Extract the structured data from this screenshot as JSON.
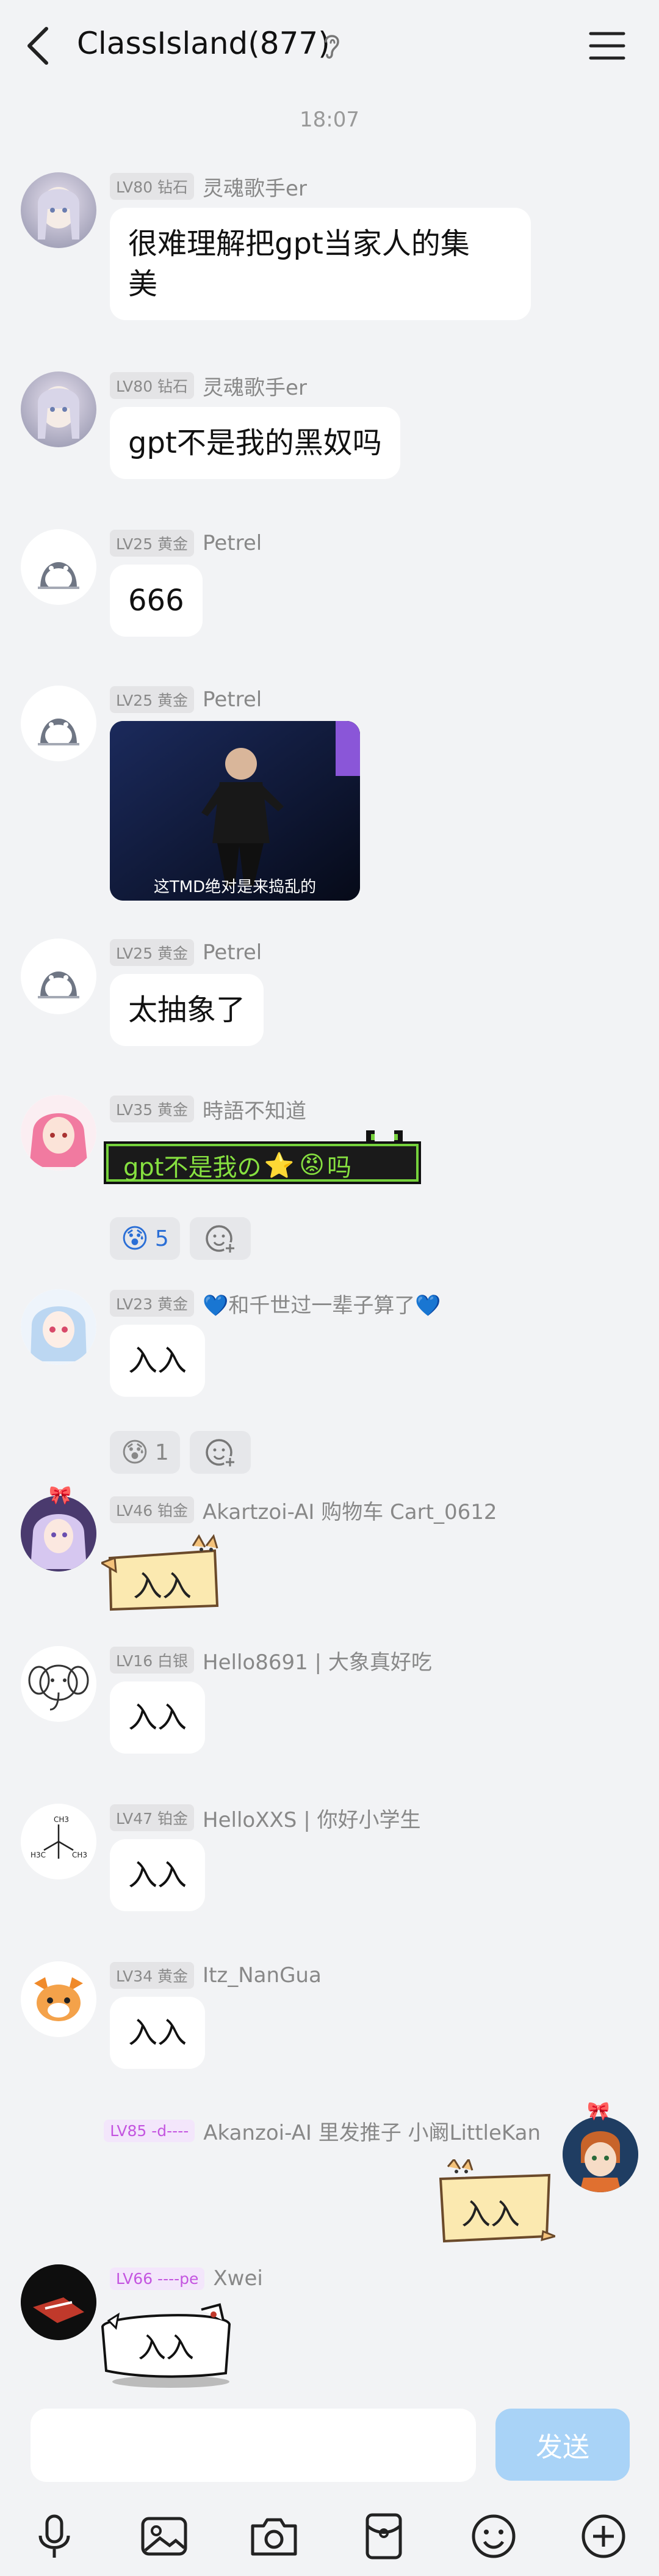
{
  "header": {
    "title": "ClassIsland(877)",
    "icons": [
      "back-arrow-icon",
      "ear-icon",
      "menu-icon"
    ]
  },
  "time_label": "18:07",
  "messages": [
    {
      "level": "LV80 钻石",
      "name": "灵魂歌手er",
      "text": "很难理解把gpt当家人的集美",
      "text_line1": "很难理解把gpt当家人的集",
      "text_line2": "美"
    },
    {
      "level": "LV80 钻石",
      "name": "灵魂歌手er",
      "text": "gpt不是我的黑奴吗"
    },
    {
      "level": "LV25 黄金",
      "name": "Petrel",
      "text": "666"
    },
    {
      "level": "LV25 黄金",
      "name": "Petrel",
      "image_caption": "这TMD绝对是来捣乱的"
    },
    {
      "level": "LV25 黄金",
      "name": "Petrel",
      "text": "太抽象了"
    },
    {
      "level": "LV35 黄金",
      "name": "時語不知道",
      "sticker_text": "gpt不是我の",
      "sticker_text_end": "吗",
      "reaction_count": "5"
    },
    {
      "level": "LV23 黄金",
      "name": "💙和千世过一辈子算了💙",
      "text": "入入",
      "reaction_count": "1"
    },
    {
      "level": "LV46 铂金",
      "name": "Akartzoi-AI 购物车 Cart_0612",
      "sticker_text": "入入"
    },
    {
      "level": "LV16 白银",
      "name": "Hello8691 | 大象真好吃",
      "text": "入入"
    },
    {
      "level": "LV47 铂金",
      "name": "HelloXXS | 你好小学生",
      "text": "入入"
    },
    {
      "level": "LV34 黄金",
      "name": "Itz_NanGua",
      "text": "入入"
    },
    {
      "level": "LV85 -d----",
      "name": "Akanzoi-AI 里发推子 小阚LittleKan",
      "sticker_text": "入入"
    },
    {
      "level": "LV66 ----pe",
      "name": "Xwei",
      "sticker_text": "入入"
    }
  ],
  "input": {
    "placeholder": "",
    "send_label": "发送"
  },
  "toolbar": [
    "microphone-icon",
    "image-icon",
    "camera-icon",
    "red-packet-icon",
    "emoji-icon",
    "plus-icon"
  ],
  "colors": {
    "background": "#f2f3f5",
    "send_button": "#a9d3f7",
    "reaction_count": "#2b6fd6"
  }
}
